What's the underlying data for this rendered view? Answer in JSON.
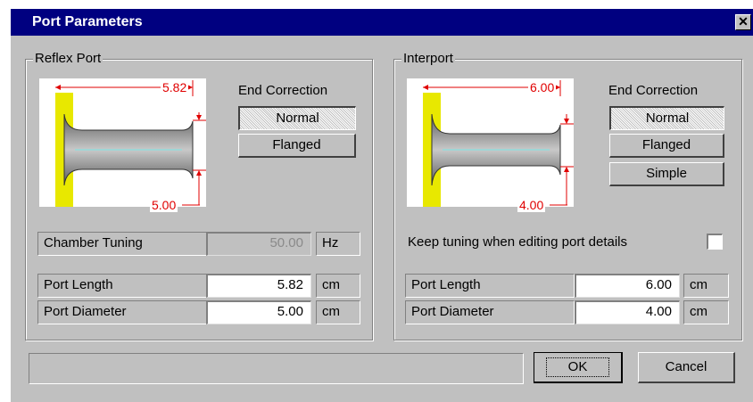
{
  "window": {
    "title": "Port Parameters",
    "close_glyph": "✕"
  },
  "reflex_port": {
    "group_label": "Reflex Port",
    "diagram": {
      "length_label": "5.82",
      "diameter_label": "5.00"
    },
    "end_correction": {
      "heading": "End Correction",
      "options": [
        "Normal",
        "Flanged"
      ],
      "selected": "Normal"
    },
    "chamber_tuning": {
      "label": "Chamber Tuning",
      "value": "50.00",
      "unit": "Hz"
    },
    "port_length": {
      "label": "Port Length",
      "value": "5.82",
      "unit": "cm"
    },
    "port_diameter": {
      "label": "Port Diameter",
      "value": "5.00",
      "unit": "cm"
    }
  },
  "interport": {
    "group_label": "Interport",
    "diagram": {
      "length_label": "6.00",
      "diameter_label": "4.00"
    },
    "end_correction": {
      "heading": "End Correction",
      "options": [
        "Normal",
        "Flanged",
        "Simple"
      ],
      "selected": "Normal"
    },
    "keep_tuning": {
      "label": "Keep tuning when editing port details",
      "checked": false
    },
    "port_length": {
      "label": "Port Length",
      "value": "6.00",
      "unit": "cm"
    },
    "port_diameter": {
      "label": "Port Diameter",
      "value": "4.00",
      "unit": "cm"
    }
  },
  "footer": {
    "status": "",
    "ok_label": "OK",
    "cancel_label": "Cancel"
  }
}
